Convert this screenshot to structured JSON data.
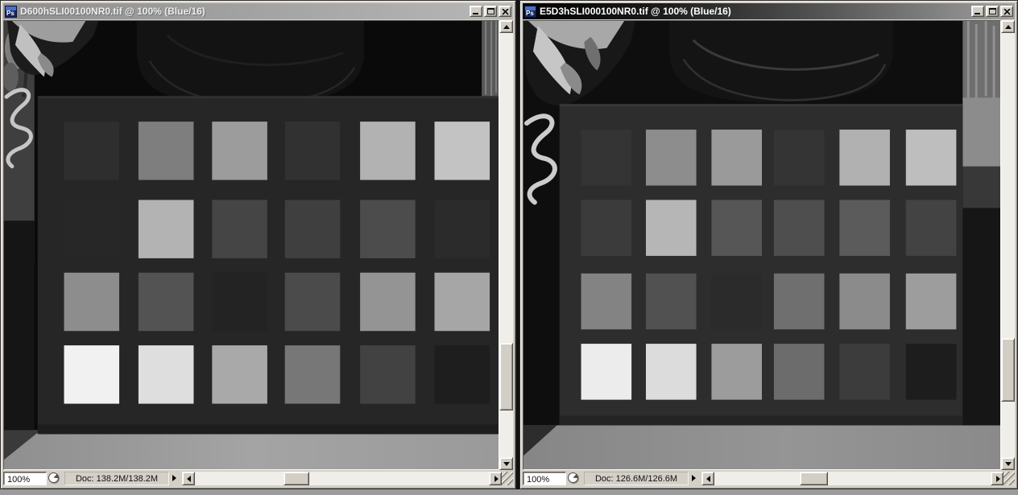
{
  "desktop": {
    "bottom_strip_color": "#9b9b9b",
    "background_color": "#121212"
  },
  "windows": [
    {
      "id": "left",
      "active": false,
      "title": "D600hSLI00100NR0.tif @ 100% (Blue/16)",
      "file_icon_label": "Ps",
      "controls": {
        "minimize": "minimize",
        "maximize": "maximize",
        "close": "close"
      },
      "status": {
        "zoom": "100%",
        "doc": "Doc: 138.2M/138.2M"
      },
      "scene": {
        "bg_color": "#0a0a0a",
        "board_color": "#262626",
        "floor_color": "#9e9e9e",
        "patches": [
          [
            "#2e2e2e",
            "#7e7e7e",
            "#9c9c9c",
            "#313131",
            "#b2b2b2",
            "#c3c3c3"
          ],
          [
            "#272727",
            "#b3b3b3",
            "#454545",
            "#3f3f3f",
            "#4c4c4c",
            "#2b2b2b"
          ],
          [
            "#8d8d8d",
            "#535353",
            "#232323",
            "#4b4b4b",
            "#949494",
            "#a6a6a6"
          ],
          [
            "#f1f1f1",
            "#dedede",
            "#a9a9a9",
            "#777777",
            "#424242",
            "#1e1e1e"
          ]
        ]
      }
    },
    {
      "id": "right",
      "active": true,
      "title": "E5D3hSLI000100NR0.tif @ 100% (Blue/16)",
      "file_icon_label": "Ps",
      "controls": {
        "minimize": "minimize",
        "maximize": "maximize",
        "close": "close"
      },
      "status": {
        "zoom": "100%",
        "doc": "Doc: 126.6M/126.6M"
      },
      "scene": {
        "bg_color": "#0e0e0e",
        "board_color": "#2d2d2d",
        "floor_color": "#8e8e8e",
        "patches": [
          [
            "#343434",
            "#8d8d8d",
            "#9a9a9a",
            "#343434",
            "#b1b1b1",
            "#bebebe"
          ],
          [
            "#3b3b3b",
            "#b6b6b6",
            "#565656",
            "#4e4e4e",
            "#5b5b5b",
            "#434343"
          ],
          [
            "#838383",
            "#515151",
            "#2b2b2b",
            "#6f6f6f",
            "#8b8b8b",
            "#9d9d9d"
          ],
          [
            "#ececec",
            "#dcdcdc",
            "#9c9c9c",
            "#6c6c6c",
            "#3c3c3c",
            "#1d1d1d"
          ]
        ]
      }
    }
  ]
}
